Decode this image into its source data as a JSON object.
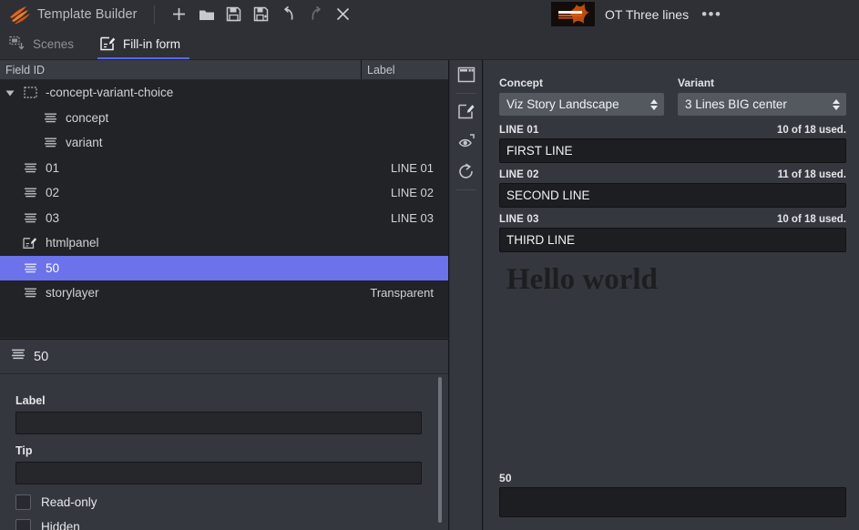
{
  "titlebar": {
    "app_title": "Template Builder",
    "logo_icon": "viz-flame-logo",
    "buttons": [
      {
        "name": "new-button",
        "icon": "plus-icon",
        "enabled": true
      },
      {
        "name": "open-button",
        "icon": "folder-open-icon",
        "enabled": true
      },
      {
        "name": "save-button",
        "icon": "save-floppy-icon",
        "enabled": true
      },
      {
        "name": "save-as-button",
        "icon": "save-as-floppy-icon",
        "enabled": true
      },
      {
        "name": "undo-button",
        "icon": "undo-arrow-icon",
        "enabled": true
      },
      {
        "name": "redo-button",
        "icon": "redo-arrow-icon",
        "enabled": false
      },
      {
        "name": "close-button",
        "icon": "close-x-icon",
        "enabled": true
      }
    ],
    "document": {
      "thumbnail_icon": "scene-thumbnail",
      "name": "OT Three lines",
      "more_icon": "ellipsis-icon",
      "more_label": "•••"
    }
  },
  "tabs": [
    {
      "label": "Scenes",
      "icon": "scenes-icon",
      "active": false
    },
    {
      "label": "Fill-in form",
      "icon": "fill-in-form-icon",
      "active": true
    }
  ],
  "tree": {
    "columns": [
      "Field ID",
      "Label"
    ],
    "rows": [
      {
        "indent": 0,
        "caret": "expanded",
        "icon": "group-dashed-icon",
        "field_id": "-concept-variant-choice",
        "label": "",
        "selected": false
      },
      {
        "indent": 2,
        "caret": "none",
        "icon": "text-lines-icon",
        "field_id": "concept",
        "label": "",
        "selected": false
      },
      {
        "indent": 2,
        "caret": "none",
        "icon": "text-lines-icon",
        "field_id": "variant",
        "label": "",
        "selected": false
      },
      {
        "indent": 1,
        "caret": "none",
        "icon": "text-lines-icon",
        "field_id": "01",
        "label": "LINE 01",
        "selected": false
      },
      {
        "indent": 1,
        "caret": "none",
        "icon": "text-lines-icon",
        "field_id": "02",
        "label": "LINE 02",
        "selected": false
      },
      {
        "indent": 1,
        "caret": "none",
        "icon": "text-lines-icon",
        "field_id": "03",
        "label": "LINE 03",
        "selected": false
      },
      {
        "indent": 1,
        "caret": "none",
        "icon": "html-panel-icon",
        "field_id": "htmlpanel",
        "label": "",
        "selected": false
      },
      {
        "indent": 1,
        "caret": "none",
        "icon": "text-lines-icon",
        "field_id": "50",
        "label": "",
        "selected": true
      },
      {
        "indent": 1,
        "caret": "none",
        "icon": "text-lines-icon",
        "field_id": "storylayer",
        "label": "Transparent",
        "selected": false
      }
    ]
  },
  "properties": {
    "header_icon": "text-lines-icon",
    "header_title": "50",
    "label_caption": "Label",
    "label_value": "",
    "label_placeholder": "",
    "tip_caption": "Tip",
    "tip_value": "",
    "tip_placeholder": "",
    "readonly_label": "Read-only",
    "readonly_checked": false,
    "hidden_label": "Hidden",
    "hidden_checked": false
  },
  "icon_strip": [
    {
      "name": "window-preview-icon",
      "active": true
    },
    {
      "name": "edit-pencil-icon",
      "active": false
    },
    {
      "name": "eye-preview-icon",
      "active": false
    },
    {
      "name": "refresh-icon",
      "active": false
    }
  ],
  "form": {
    "concept": {
      "caption": "Concept",
      "value": "Viz Story Landscape",
      "spinner_icon": "spinner-updown-icon"
    },
    "variant": {
      "caption": "Variant",
      "value": "3 Lines BIG center",
      "spinner_icon": "spinner-updown-icon"
    },
    "fields": [
      {
        "name": "LINE 01",
        "count": "10 of 18 used.",
        "value": "FIRST LINE"
      },
      {
        "name": "LINE 02",
        "count": "11 of 18 used.",
        "value": "SECOND LINE"
      },
      {
        "name": "LINE 03",
        "count": "10 of 18 used.",
        "value": "THIRD LINE"
      }
    ],
    "preview_text": "Hello world",
    "bottom_field": {
      "name": "50",
      "value": ""
    }
  },
  "colors": {
    "accent_blue": "#5865f2",
    "selection_blue": "#6b72ea",
    "panel_bg": "#34373d",
    "tree_bg": "#212327",
    "titlebar_bg": "#2e3035",
    "input_bg": "#1c1e22",
    "brand_orange": "#e8621a"
  }
}
